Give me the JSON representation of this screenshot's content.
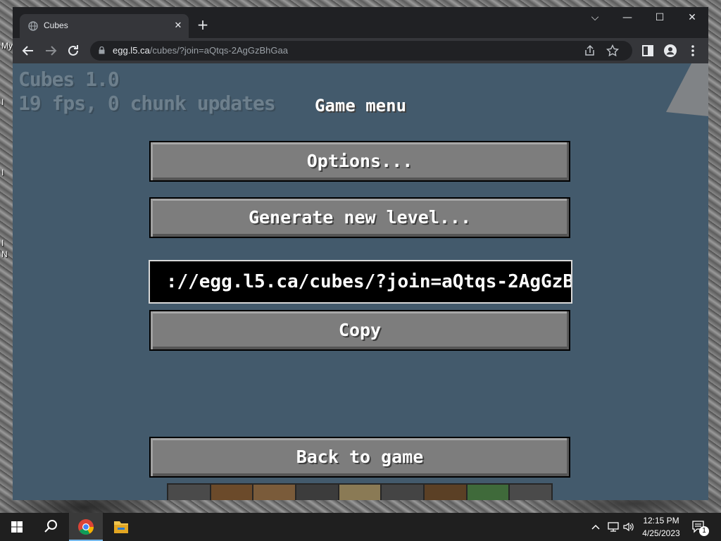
{
  "desktop": {
    "labels": [
      "My",
      "I",
      "I",
      "I",
      "N"
    ]
  },
  "browser": {
    "tab_title": "Cubes",
    "close_tab_glyph": "✕",
    "new_tab_glyph": "+",
    "url_host": "egg.l5.ca",
    "url_path": "/cubes/?join=aQtqs-2AgGzBhGaa",
    "window_controls": {
      "collapse": "⌵",
      "minimize": "—",
      "maximize": "☐",
      "close": "✕"
    },
    "icons": [
      "globe-icon",
      "back-icon",
      "forward-icon",
      "reload-icon",
      "lock-icon",
      "share-icon",
      "star-icon",
      "side-panel-icon",
      "profile-icon",
      "menu-icon"
    ]
  },
  "game": {
    "hud_line1": "Cubes 1.0",
    "hud_line2": "19 fps, 0 chunk updates",
    "menu_title": "Game menu",
    "buttons": {
      "options": "Options...",
      "generate": "Generate new level...",
      "copy": "Copy",
      "back": "Back to game"
    },
    "join_link_visible": "://egg.l5.ca/cubes/?join=aQtqs-2AgGzB",
    "hotbar_slots": 9
  },
  "taskbar": {
    "time": "12:15 PM",
    "date": "4/25/2023",
    "notification_count": "1",
    "icons": [
      "windows-start-icon",
      "search-icon",
      "chrome-icon",
      "file-explorer-icon",
      "chevron-up-icon",
      "network-icon",
      "volume-icon",
      "notification-icon"
    ]
  },
  "colors": {
    "game_background": "#435a6c",
    "button_face": "#7d7d7d",
    "chrome_dark": "#202124"
  }
}
